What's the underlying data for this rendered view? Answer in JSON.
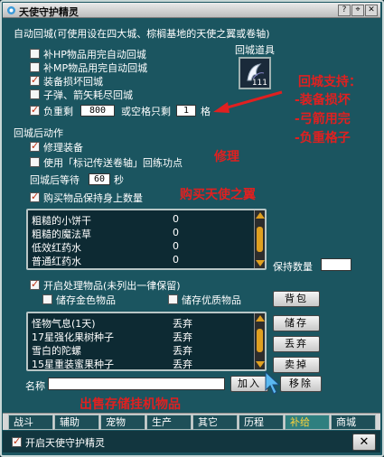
{
  "window": {
    "title": "天使守护精灵"
  },
  "auto_return": {
    "heading": "自动回城(可使用设在四大城、棕榈基地的天使之翼或卷轴)",
    "item_slot_label": "回城道具",
    "item_count": "111",
    "options": [
      {
        "label": "补HP物品用完自动回城",
        "checked": false
      },
      {
        "label": "补MP物品用完自动回城",
        "checked": false
      },
      {
        "label": "装备损坏回城",
        "checked": true
      },
      {
        "label": "子弹、箭矢耗尽回城",
        "checked": false
      }
    ],
    "weight_option": {
      "prefix": "负重剩",
      "value": "800",
      "middle": "或空格只剩",
      "slots": "1",
      "suffix": "格",
      "checked": true
    }
  },
  "after_return": {
    "heading": "回城后动作",
    "repair": {
      "label": "修理装备",
      "checked": true
    },
    "mark_scroll": {
      "label": "使用「标记传送卷轴」回练功点",
      "checked": false
    },
    "wait": {
      "prefix": "回城后等待",
      "value": "60",
      "suffix": "秒"
    },
    "buy": {
      "label": "购买物品保持身上数量",
      "checked": true
    }
  },
  "buy_list": {
    "items": [
      {
        "name": "粗糙的小饼干",
        "qty": "0"
      },
      {
        "name": "粗糙的魔法草",
        "qty": "0"
      },
      {
        "name": "低效红药水",
        "qty": "0"
      },
      {
        "name": "普通红药水",
        "qty": "0"
      }
    ],
    "keep_label": "保持数量",
    "keep_value": ""
  },
  "process": {
    "enable": {
      "label": "开启处理物品(未列出一律保留)",
      "checked": true
    },
    "store_gold": {
      "label": "储存金色物品",
      "checked": false
    },
    "store_quality": {
      "label": "储存优质物品",
      "checked": false
    },
    "bag_button": "背包",
    "items": [
      {
        "name": "怪物气息(1天)",
        "action": "丢弃"
      },
      {
        "name": "17星强化果树种子",
        "action": "丢弃"
      },
      {
        "name": "雪白的陀螺",
        "action": "丢弃"
      },
      {
        "name": "15星重装蜜果种子",
        "action": "丢弃"
      }
    ],
    "store_button": "储存",
    "discard_button": "丢弃",
    "sell_button": "卖掉",
    "name_label": "名称",
    "name_value": "",
    "add_button": "加入",
    "remove_button": "移除"
  },
  "annotations": {
    "return_support_title": "回城支持：",
    "return_support_items": [
      "-装备损坏",
      "-弓箭用完",
      "-负重格子"
    ],
    "repair_note": "修理",
    "buy_note": "购买天使之翼",
    "sell_note": "出售存储挂机物品"
  },
  "tabs": [
    "战斗",
    "辅助",
    "宠物",
    "生产",
    "其它",
    "历程",
    "补给",
    "商城"
  ],
  "active_tab": "补给",
  "footer": {
    "enable_label": "开启天使守护精灵",
    "checked": true
  },
  "colors": {
    "window_bg": "#1b5560",
    "list_bg": "#0d2a33",
    "annotation_red": "#e02020",
    "active_tab_text": "#ffd43b"
  }
}
